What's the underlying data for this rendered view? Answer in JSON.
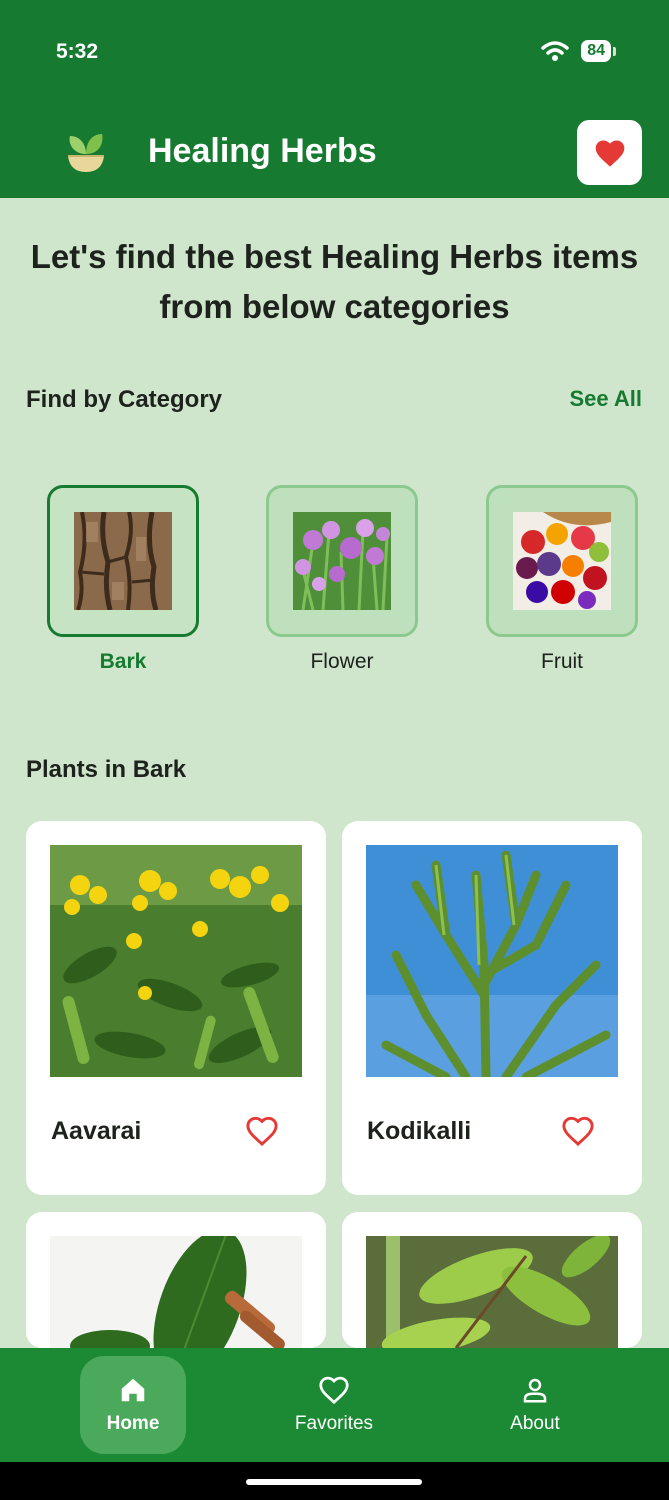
{
  "status": {
    "time": "5:32",
    "battery": "84"
  },
  "app": {
    "title": "Healing Herbs"
  },
  "headline": "Let's find the best Healing Herbs items from below categories",
  "category_section": {
    "title": "Find by Category",
    "see_all": "See All"
  },
  "categories": [
    {
      "label": "Bark",
      "selected": true
    },
    {
      "label": "Flower",
      "selected": false
    },
    {
      "label": "Fruit",
      "selected": false
    }
  ],
  "plants_section": {
    "title": "Plants in Bark"
  },
  "plants": [
    {
      "name": "Aavarai"
    },
    {
      "name": "Kodikalli"
    },
    {
      "name": ""
    },
    {
      "name": ""
    }
  ],
  "nav": [
    {
      "label": "Home",
      "icon": "home-icon",
      "active": true
    },
    {
      "label": "Favorites",
      "icon": "heart-icon",
      "active": false
    },
    {
      "label": "About",
      "icon": "person-icon",
      "active": false
    }
  ],
  "colors": {
    "primary": "#177a31",
    "background": "#cfe6cc",
    "heart": "#e53935"
  }
}
